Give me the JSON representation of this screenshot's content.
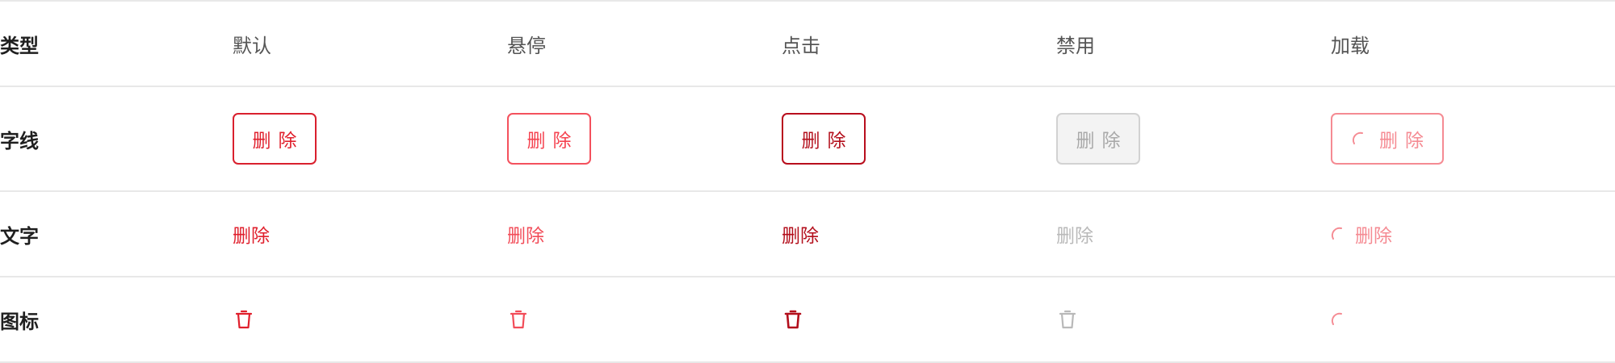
{
  "table": {
    "header": {
      "row_label": "类型",
      "columns": [
        "默认",
        "悬停",
        "点击",
        "禁用",
        "加载"
      ]
    },
    "rows": {
      "outline": {
        "label": "字线",
        "button_text": "删除"
      },
      "text": {
        "label": "文字",
        "button_text": "删除"
      },
      "icon": {
        "label": "图标",
        "icon_name": "trash-icon"
      }
    }
  },
  "colors": {
    "default": "#e0202d",
    "hover": "#f24d59",
    "active": "#b30f1c",
    "disabled": "#b9b9b9",
    "loading": "#f58b93"
  }
}
